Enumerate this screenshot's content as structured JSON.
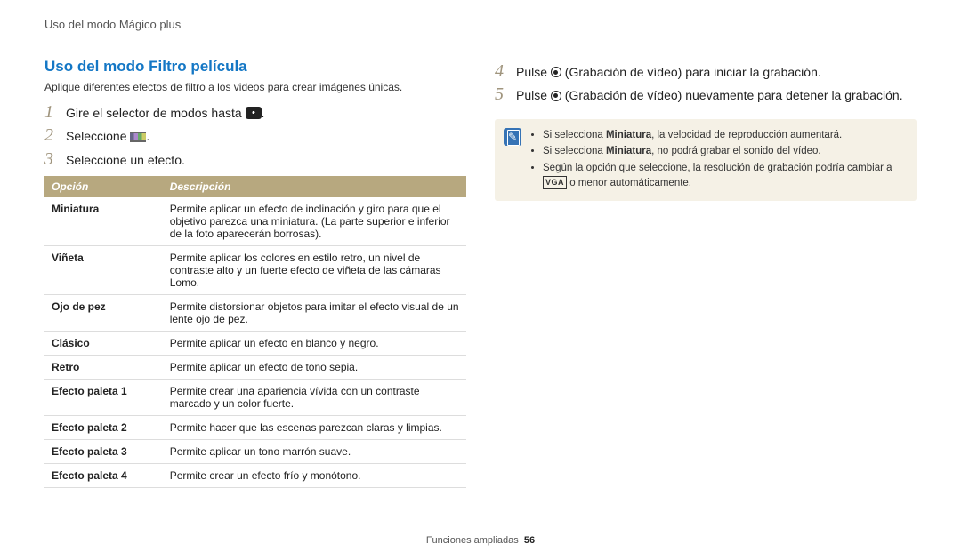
{
  "breadcrumb": "Uso del modo Mágico plus",
  "section_title": "Uso del modo Filtro película",
  "intro": "Aplique diferentes efectos de filtro a los videos para crear imágenes únicas.",
  "left_steps": [
    {
      "num": "1",
      "pre": "Gire el selector de modos hasta ",
      "icon": "mode",
      "post": "."
    },
    {
      "num": "2",
      "pre": "Seleccione ",
      "icon": "film",
      "post": "."
    },
    {
      "num": "3",
      "pre": "Seleccione un efecto.",
      "icon": "",
      "post": ""
    }
  ],
  "right_steps": [
    {
      "num": "4",
      "pre": "Pulse ",
      "icon": "record",
      "post": " (Grabación de vídeo) para iniciar la grabación."
    },
    {
      "num": "5",
      "pre": "Pulse ",
      "icon": "record",
      "post": " (Grabación de vídeo) nuevamente para detener la grabación."
    }
  ],
  "table": {
    "head_option": "Opción",
    "head_desc": "Descripción",
    "rows": [
      {
        "opt": "Miniatura",
        "desc": "Permite aplicar un efecto de inclinación y giro para que el objetivo parezca una miniatura. (La parte superior e inferior de la foto aparecerán borrosas)."
      },
      {
        "opt": "Viñeta",
        "desc": "Permite aplicar los colores en estilo retro, un nivel de contraste alto y un fuerte efecto de viñeta de las cámaras Lomo."
      },
      {
        "opt": "Ojo de pez",
        "desc": "Permite distorsionar objetos para imitar el efecto visual de un lente ojo de pez."
      },
      {
        "opt": "Clásico",
        "desc": "Permite aplicar un efecto en blanco y negro."
      },
      {
        "opt": "Retro",
        "desc": "Permite aplicar un efecto de tono sepia."
      },
      {
        "opt": "Efecto paleta 1",
        "desc": "Permite crear una apariencia vívida con un contraste marcado y un color fuerte."
      },
      {
        "opt": "Efecto paleta 2",
        "desc": "Permite hacer que las escenas parezcan claras y limpias."
      },
      {
        "opt": "Efecto paleta 3",
        "desc": "Permite aplicar un tono marrón suave."
      },
      {
        "opt": "Efecto paleta 4",
        "desc": "Permite crear un efecto frío y monótono."
      }
    ]
  },
  "notes": {
    "item1_pre": "Si selecciona ",
    "item1_bold": "Miniatura",
    "item1_post": ", la velocidad de reproducción aumentará.",
    "item2_pre": "Si selecciona ",
    "item2_bold": "Miniatura",
    "item2_post": ", no podrá grabar el sonido del vídeo.",
    "item3_pre": "Según la opción que seleccione, la resolución de grabación podría cambiar a ",
    "item3_vga": "VGA",
    "item3_post": " o menor automáticamente."
  },
  "footer": {
    "label": "Funciones ampliadas",
    "page": "56"
  }
}
